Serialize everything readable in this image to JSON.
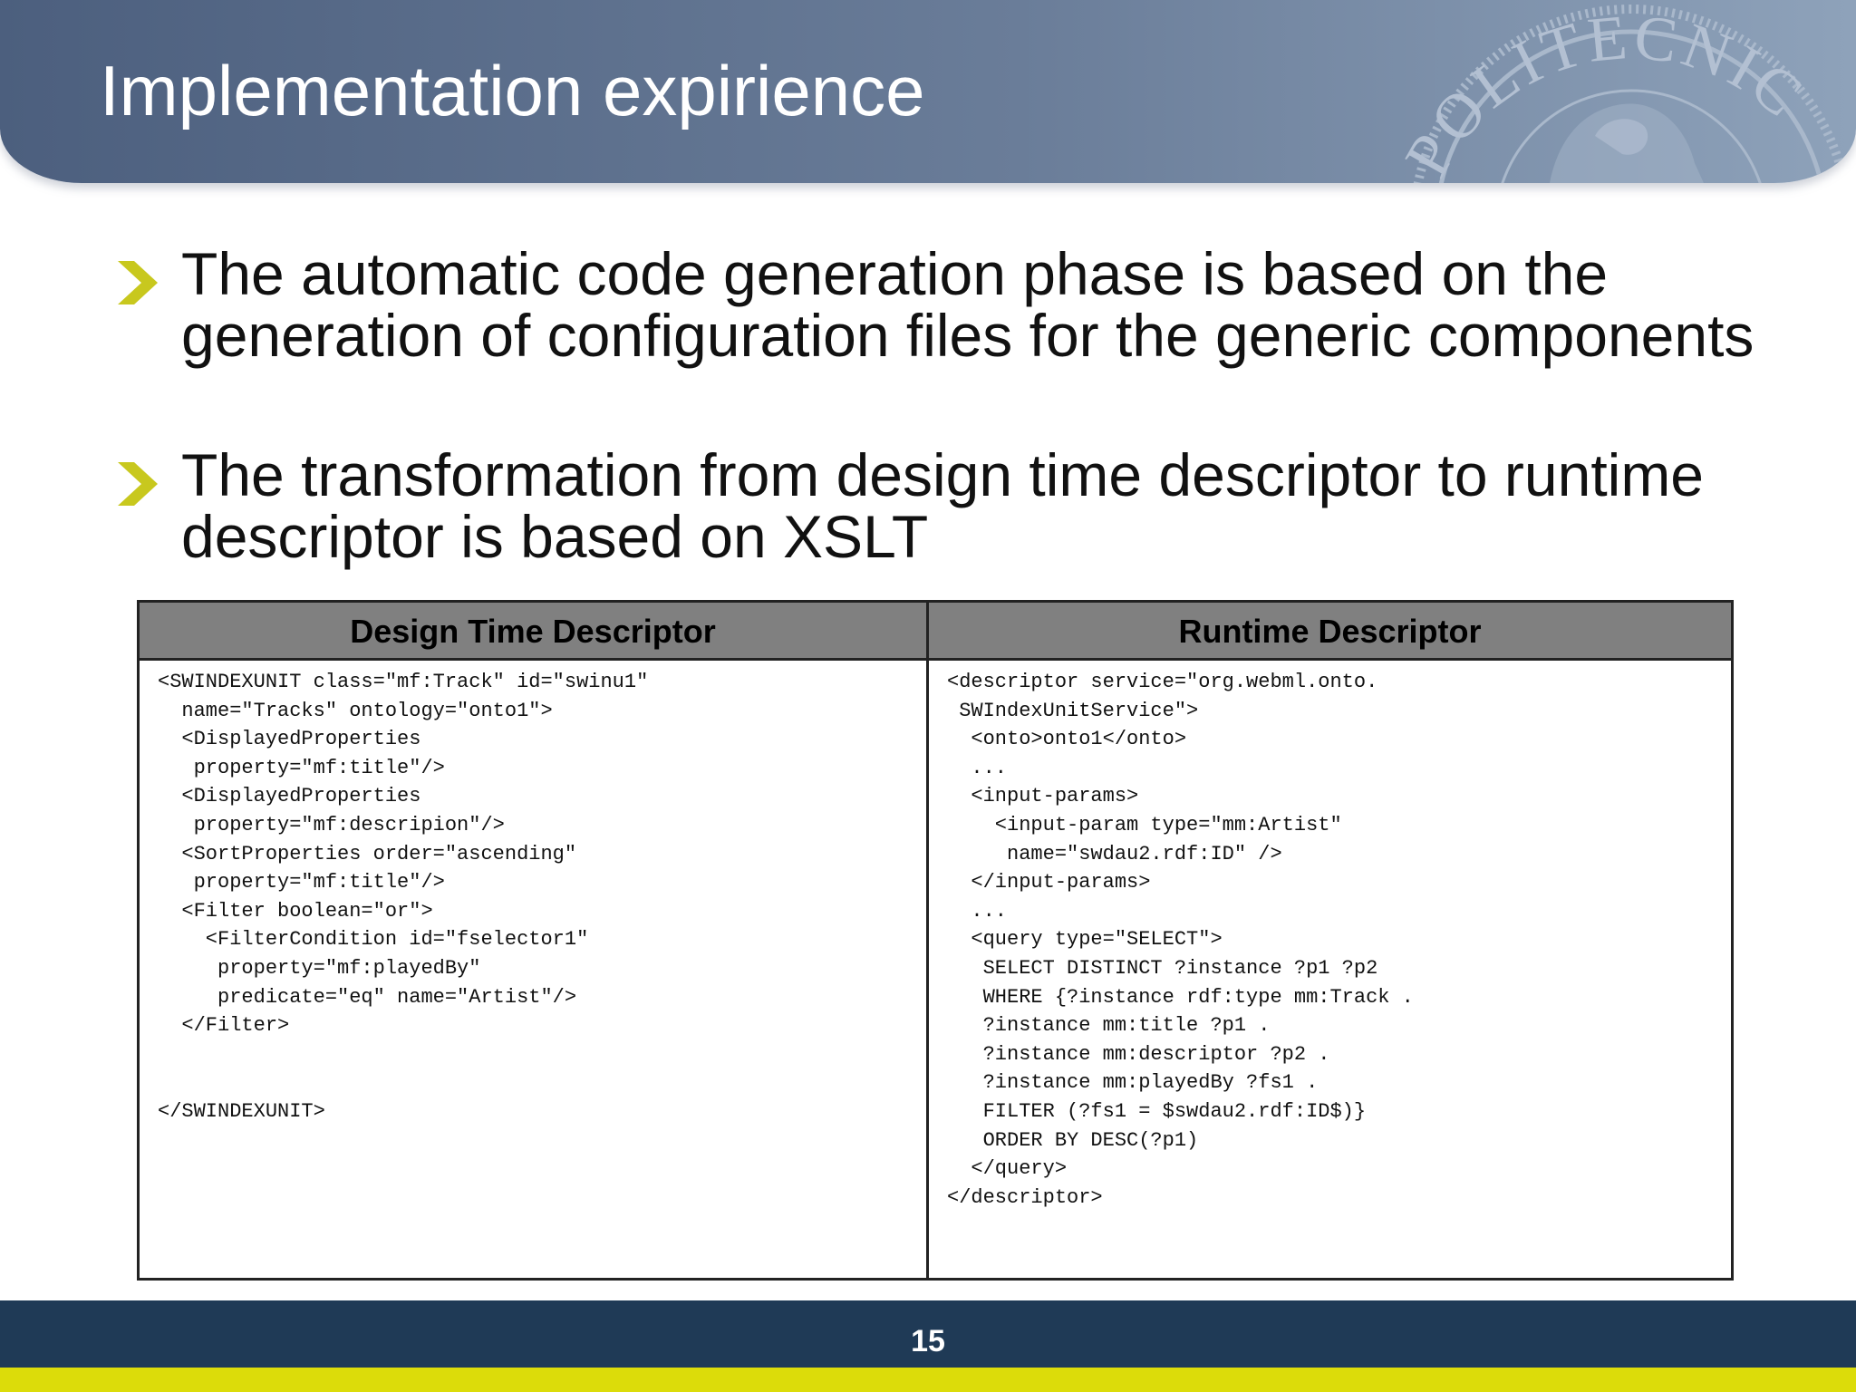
{
  "slide": {
    "title": "Implementation expirience",
    "seal_text": "POLITECNICO",
    "page_number": "15"
  },
  "bullets": [
    {
      "text": "The automatic code generation phase is based on the generation of configuration files for the generic components"
    },
    {
      "text": "The transformation from design time descriptor to runtime descriptor is based on XSLT"
    }
  ],
  "descriptor_table": {
    "left": {
      "header": "Design Time Descriptor",
      "code": "<SWINDEXUNIT class=\"mf:Track\" id=\"swinu1\"\n  name=\"Tracks\" ontology=\"onto1\">\n  <DisplayedProperties\n   property=\"mf:title\"/>\n  <DisplayedProperties\n   property=\"mf:descripion\"/>\n  <SortProperties order=\"ascending\"\n   property=\"mf:title\"/>\n  <Filter boolean=\"or\">\n    <FilterCondition id=\"fselector1\"\n     property=\"mf:playedBy\"\n     predicate=\"eq\" name=\"Artist\"/>\n  </Filter>\n\n\n</SWINDEXUNIT>"
    },
    "right": {
      "header": "Runtime Descriptor",
      "code": "<descriptor service=\"org.webml.onto.\n SWIndexUnitService\">\n  <onto>onto1</onto>\n  ...\n  <input-params>\n    <input-param type=\"mm:Artist\"\n     name=\"swdau2.rdf:ID\" />\n  </input-params>\n  ...\n  <query type=\"SELECT\">\n   SELECT DISTINCT ?instance ?p1 ?p2\n   WHERE {?instance rdf:type mm:Track .\n   ?instance mm:title ?p1 .\n   ?instance mm:descriptor ?p2 .\n   ?instance mm:playedBy ?fs1 .\n   FILTER (?fs1 = $swdau2.rdf:ID$)}\n   ORDER BY DESC(?p1)\n  </query>\n</descriptor>"
    }
  },
  "colors": {
    "header_start": "#4c5f7e",
    "header_end": "#8ea2ba",
    "bullet_marker": "#c8c81e",
    "table_header": "#808080",
    "footer": "#1f3a56",
    "accent_bar": "#dcdc0a"
  },
  "icons": {
    "bullet": "chevron-right-icon",
    "seal": "university-seal-icon"
  }
}
